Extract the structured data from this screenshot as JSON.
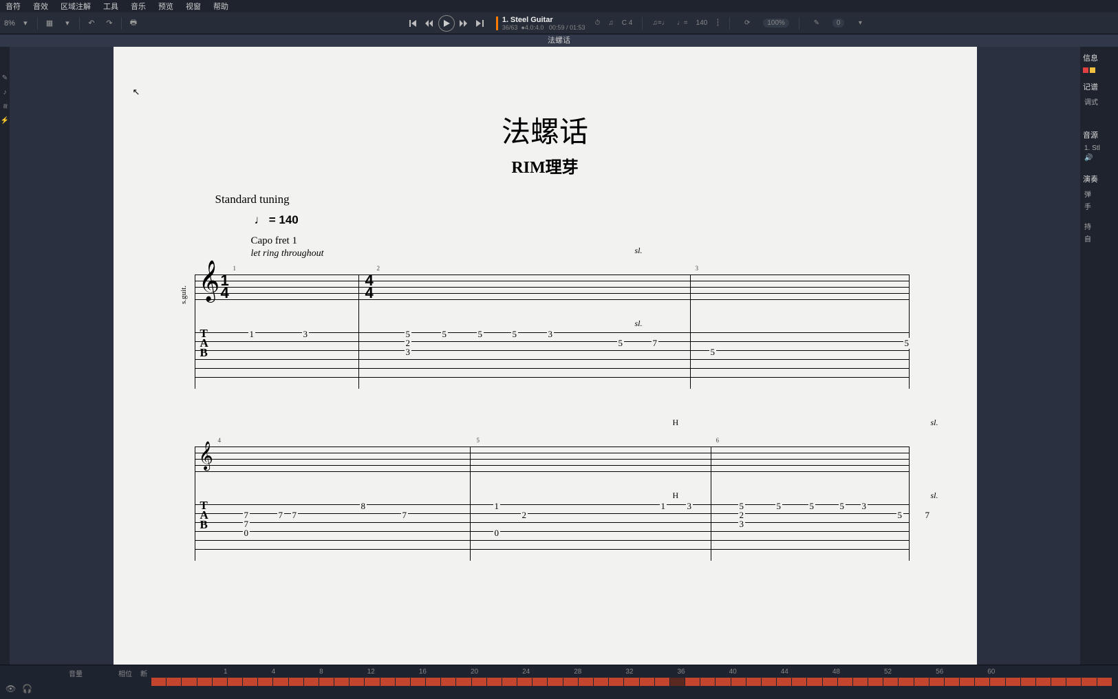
{
  "menu": [
    "音符",
    "音效",
    "区域注解",
    "工具",
    "音乐",
    "预览",
    "视窗",
    "帮助"
  ],
  "zoom": "8%",
  "track": {
    "number": "1.",
    "name": "Steel Guitar",
    "bars": "36/63",
    "beat": "4.0:4.0",
    "time": "00:59 / 01:53",
    "tempo_n": "140",
    "key": "C 4"
  },
  "looppct": "100%",
  "tab_title": "法螺话",
  "sheet": {
    "title": "法螺话",
    "subtitle": "RIM理芽",
    "tuning": "Standard tuning",
    "tempo": "= 140",
    "capo": "Capo fret 1",
    "letring": "let ring throughout"
  },
  "rightpanel": {
    "info": "信息",
    "notation": "记谱",
    "tune_label": "调式",
    "sound": "音源",
    "track1": "1. Stl",
    "perform": "演奏",
    "p1": "弹",
    "p2": "手",
    "p3": "持",
    "p4": "自"
  },
  "timeline": {
    "vol": "音量",
    "pan": "相位",
    "cut": "断",
    "marks": [
      "1",
      "4",
      "8",
      "12",
      "16",
      "20",
      "24",
      "28",
      "32",
      "36",
      "40",
      "44",
      "48",
      "52",
      "56",
      "60"
    ]
  },
  "system1": {
    "measures": [
      "1",
      "2",
      "3"
    ],
    "ts1": {
      "n": "1",
      "d": "4"
    },
    "ts2": {
      "n": "4",
      "d": "4"
    },
    "sl": "sl.",
    "tab": {
      "m1": [
        "1",
        "3"
      ],
      "m2_top": [
        "5",
        "5",
        "5",
        "5",
        "3"
      ],
      "m2_mid": [
        "2",
        "5",
        "7"
      ],
      "m2_low": [
        "3"
      ],
      "m3": [
        "5",
        "5"
      ]
    }
  },
  "system2": {
    "measures": [
      "4",
      "5",
      "6"
    ],
    "H": "H",
    "sl": "sl.",
    "tab": {
      "m4_top": [
        "8"
      ],
      "m4_a": [
        "7",
        "7",
        "7",
        "7"
      ],
      "m4_b": [
        "7"
      ],
      "m4_c": [
        "0"
      ],
      "m5_top": [
        "1",
        "1",
        "3"
      ],
      "m5_mid": [
        "2"
      ],
      "m5_low": [
        "0"
      ],
      "m6_top": [
        "5",
        "5",
        "5",
        "5",
        "3"
      ],
      "m6_mid": [
        "2",
        "5",
        "7"
      ],
      "m6_low": [
        "3"
      ]
    }
  }
}
